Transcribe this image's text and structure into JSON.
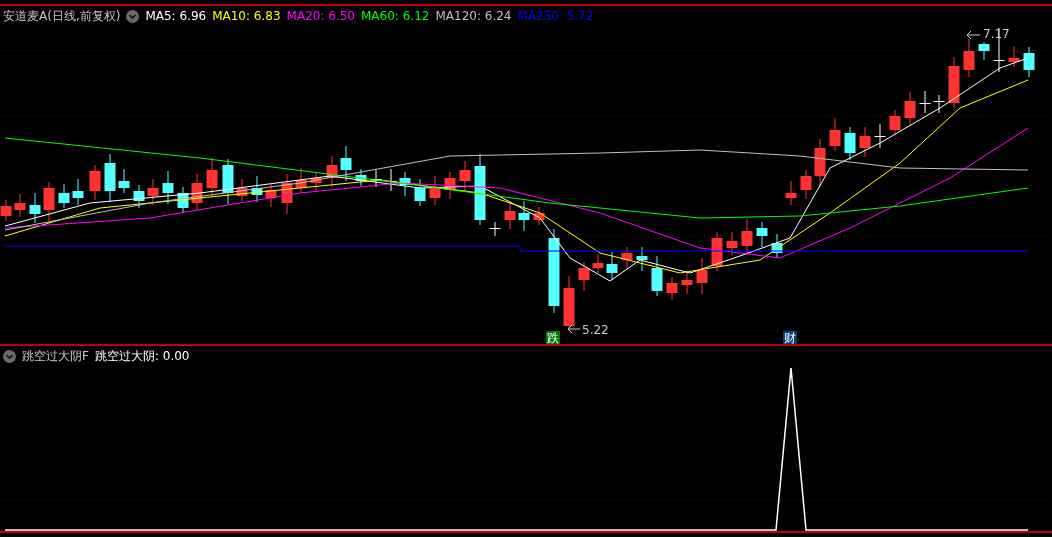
{
  "chart_header": {
    "title": "安道麦A(日线,前复权)",
    "moving_averages": [
      {
        "label": "MA5: 6.96",
        "color": "#ffffff"
      },
      {
        "label": "MA10: 6.83",
        "color": "#ffff00"
      },
      {
        "label": "MA20: 6.50",
        "color": "#ff00ff"
      },
      {
        "label": "MA60: 6.12",
        "color": "#00ff00"
      },
      {
        "label": "MA120: 6.24",
        "color": "#c0c0c0"
      },
      {
        "label": "MA250: 5.72",
        "color": "#0000ff"
      }
    ]
  },
  "price_chart": {
    "high_label": "7.17",
    "low_label": "5.22",
    "event_markers": [
      {
        "text": "跌",
        "color": "#007a00"
      },
      {
        "text": "财",
        "color": "#003f7f"
      }
    ]
  },
  "indicator": {
    "name": "跳空过大阴F",
    "reading": "跳空过大阴: 0.00"
  }
}
